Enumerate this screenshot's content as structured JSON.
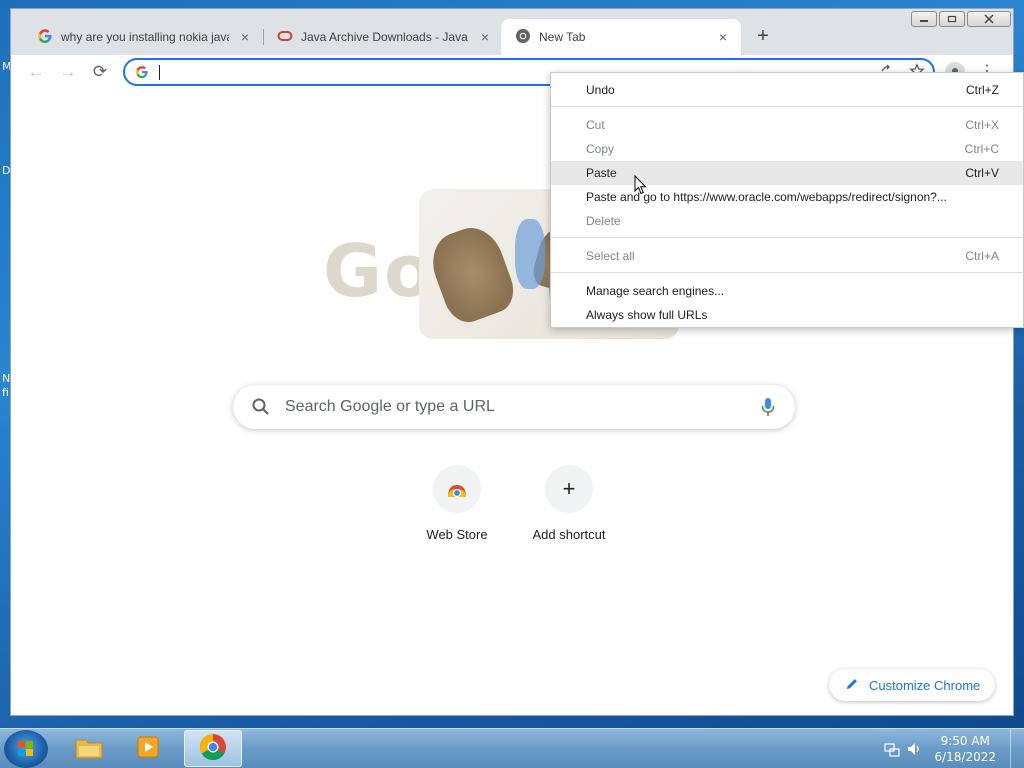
{
  "desktop": {
    "icon_fragments": [
      "M",
      "D",
      "N",
      "fi"
    ]
  },
  "window_controls": {
    "minimize": "minimize-icon",
    "restore": "restore-icon",
    "close": "close-icon"
  },
  "tabs": [
    {
      "title": "why are you installing nokia java",
      "favicon": "google-g-icon",
      "close": "×",
      "active": false
    },
    {
      "title": "Java Archive Downloads - Java SE",
      "favicon": "oracle-icon",
      "close": "×",
      "active": false
    },
    {
      "title": "New Tab",
      "favicon": "chrome-icon",
      "close": "×",
      "active": true
    }
  ],
  "newtab_button": "+",
  "toolbar": {
    "back": "←",
    "forward": "→",
    "reload": "⟳",
    "omnibox_value": "",
    "share_icon": "share-icon",
    "star_icon": "star-icon",
    "menu": "⋮"
  },
  "ntp": {
    "doodle_text": "Go",
    "search_placeholder": "Search Google or type a URL",
    "shortcuts": [
      {
        "label": "Web Store",
        "icon": "webstore-icon"
      },
      {
        "label": "Add shortcut",
        "icon": "+"
      }
    ],
    "customize_label": "Customize Chrome"
  },
  "context_menu": {
    "items": [
      {
        "label": "Undo",
        "shortcut": "Ctrl+Z",
        "disabled": false
      },
      {
        "label": "Cut",
        "shortcut": "Ctrl+X",
        "disabled": true
      },
      {
        "label": "Copy",
        "shortcut": "Ctrl+C",
        "disabled": true
      },
      {
        "label": "Paste",
        "shortcut": "Ctrl+V",
        "disabled": false,
        "hover": true
      },
      {
        "label": "Paste and go to https://www.oracle.com/webapps/redirect/signon?...",
        "shortcut": "",
        "disabled": false
      },
      {
        "label": "Delete",
        "shortcut": "",
        "disabled": true
      },
      {
        "label": "Select all",
        "shortcut": "Ctrl+A",
        "disabled": true
      },
      {
        "label": "Manage search engines...",
        "shortcut": "",
        "disabled": false
      },
      {
        "label": "Always show full URLs",
        "shortcut": "",
        "disabled": false
      }
    ]
  },
  "taskbar": {
    "apps": [
      "explorer-icon",
      "media-player-icon",
      "chrome-icon"
    ],
    "time": "9:50 AM",
    "date": "6/18/2022"
  }
}
